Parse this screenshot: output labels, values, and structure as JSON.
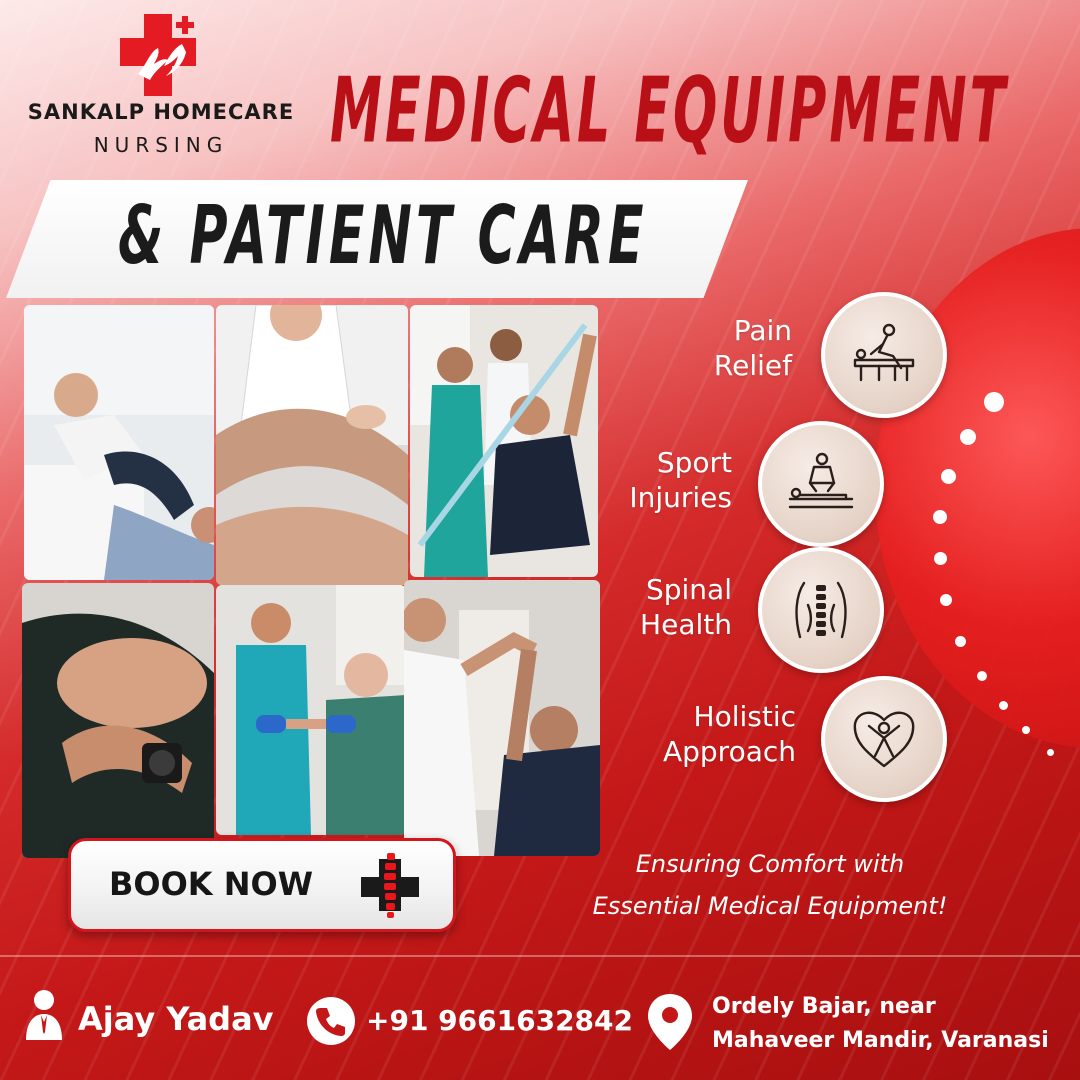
{
  "brand": {
    "name_line1": "SANKALP HOMECARE",
    "name_line2": "NURSING",
    "logo_icon": "medical-cross-hands-icon"
  },
  "headline": {
    "title": "MEDICAL EQUIPMENT",
    "subtitle": "& PATIENT CARE"
  },
  "photos": [
    {
      "subject": "leg-stretch-therapy"
    },
    {
      "subject": "knee-examination"
    },
    {
      "subject": "resistance-band-exercise"
    },
    {
      "subject": "shoulder-massage"
    },
    {
      "subject": "dumbbell-exercise"
    },
    {
      "subject": "arm-raise-assist"
    }
  ],
  "services": [
    {
      "label": "Pain\nRelief",
      "icon": "massage-table-icon"
    },
    {
      "label": "Sport\nInjuries",
      "icon": "back-massage-icon"
    },
    {
      "label": "Spinal\nHealth",
      "icon": "spine-icon"
    },
    {
      "label": "Holistic\nApproach",
      "icon": "heart-figure-icon"
    }
  ],
  "cta": {
    "label": "BOOK NOW",
    "icon": "spine-cross-icon"
  },
  "tagline": {
    "line1": "Ensuring Comfort with",
    "line2": "Essential Medical Equipment!"
  },
  "contact": {
    "name": "Ajay Yadav",
    "phone": "+91 9661632842",
    "address_line1": "Ordely Bajar, near",
    "address_line2": "Mahaveer Mandir, Varanasi"
  },
  "colors": {
    "brand_red": "#b90f16",
    "background_red": "#c41818",
    "white": "#ffffff"
  }
}
